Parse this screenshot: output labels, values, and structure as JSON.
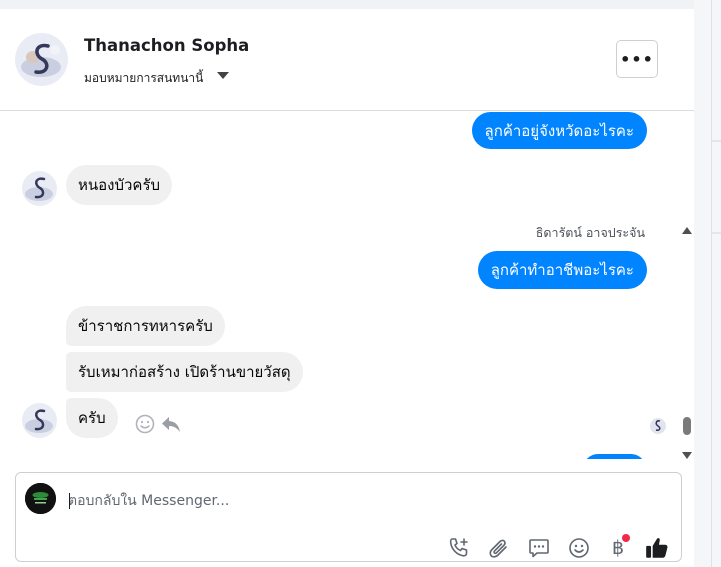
{
  "header": {
    "contact_name": "Thanachon Sopha",
    "assign_label": "มอบหมายการสนทนานี้",
    "more_label": "•••"
  },
  "chat": {
    "messages": [
      {
        "direction": "out",
        "text": "ลูกค้าอยู่จังหวัดอะไรคะ"
      },
      {
        "direction": "in",
        "text": "หนองบัวครับ"
      },
      {
        "direction": "out",
        "sender": "ธิดารัตน์ อาจประจัน",
        "text": "ลูกค้าทำอาชีพอะไรคะ"
      },
      {
        "direction": "in",
        "text": "ข้าราชการทหารครับ"
      },
      {
        "direction": "in",
        "text": "รับเหมาก่อสร้าง เปิดร้านขายวัสดุ"
      },
      {
        "direction": "in",
        "text": "ครับ"
      }
    ]
  },
  "composer": {
    "placeholder": "ตอบกลับใน Messenger...",
    "baht_symbol": "฿"
  },
  "icons": [
    "chevron-down-icon",
    "more-icon",
    "emoji-reaction-icon",
    "reply-icon",
    "call-icon",
    "attachment-icon",
    "saved-reply-icon",
    "emoji-icon",
    "baht-icon",
    "like-icon"
  ],
  "colors": {
    "outgoing_bubble": "#0084ff",
    "incoming_bubble": "#f0f0f0",
    "notification_dot": "#f02849"
  }
}
